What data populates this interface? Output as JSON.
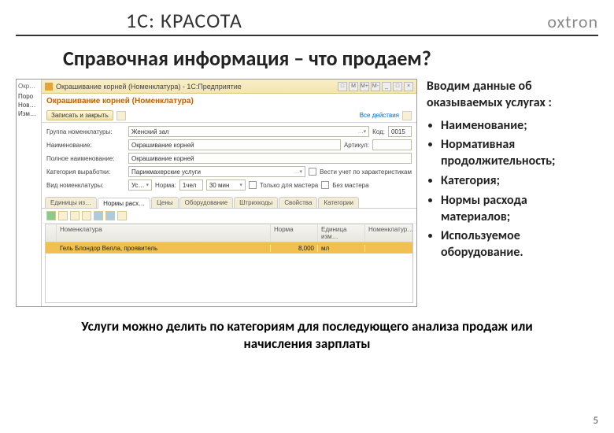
{
  "header": {
    "title": "1С: КРАСОТА",
    "logo": "oxtron"
  },
  "subtitle": "Справочная информация – что продаем?",
  "side": {
    "intro": "Вводим данные об оказываемых услугах :",
    "bullets": [
      "Наименование;",
      "Нормативная продолжительность;",
      "Категория;",
      "Нормы расхода материалов;",
      "Используемое оборудование."
    ]
  },
  "footer": "Услуги можно делить по категориям для последующего анализа продаж или начисления зарплаты",
  "page_num": "5",
  "win": {
    "titlebar": "Окрашивание корней (Номенклатура) - 1С:Предприятие",
    "titlebar_btns": [
      "□",
      "M",
      "M+",
      "M-",
      "_",
      "□",
      "×"
    ],
    "tree": {
      "title": "Окр…",
      "items": [
        "Поро",
        "Нов…",
        "Изм…"
      ]
    },
    "form_title": "Окрашивание корней (Номенклатура)",
    "toolbar": {
      "save_close": "Записать и закрыть",
      "all_actions": "Все действия"
    },
    "fields": {
      "group_label": "Группа номенклатуры:",
      "group_value": "Женский зал",
      "code_label": "Код:",
      "code_value": "0015",
      "name_label": "Наименование:",
      "name_value": "Окрашивание корней",
      "article_label": "Артикул:",
      "fullname_label": "Полное наименование:",
      "fullname_value": "Окрашивание корней",
      "category_label": "Категория выработки:",
      "category_value": "Парикмахерские услуги",
      "char_label": "Вести учет по характеристикам",
      "vid_label": "Вид номенклатуры:",
      "vid_value": "Ус…",
      "norm_label": "Норма:",
      "norm_value_h": "1чел",
      "norm_value_m": "30 мин",
      "master_only": "Только для мастера",
      "without_master": "Без мастера"
    },
    "tabs": [
      "Единицы из…",
      "Нормы расх…",
      "Цены",
      "Оборудование",
      "Штрихкоды",
      "Свойства",
      "Категории"
    ],
    "active_tab": 1,
    "grid": {
      "headers": [
        "",
        "Номенклатура",
        "Норма",
        "Единица изм…",
        "Номенклатур…"
      ],
      "row_label": "Гель Блондор Велла, проявитель",
      "row_norm": "8,000",
      "row_unit": "мл"
    }
  }
}
